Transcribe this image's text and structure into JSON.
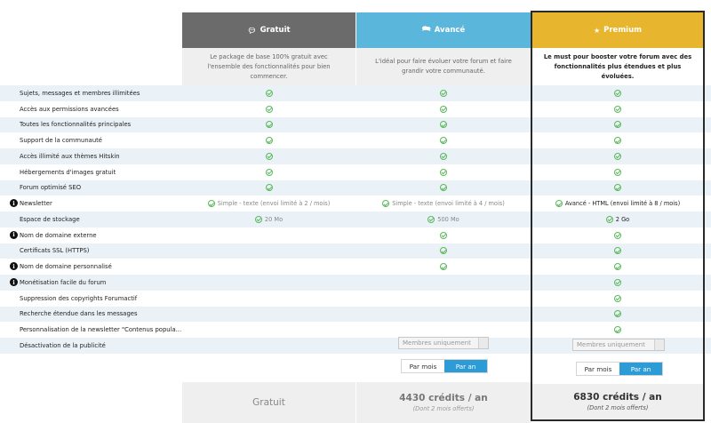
{
  "plans": {
    "gratuit": {
      "name": "Gratuit",
      "icon": "comment-icon",
      "color": "#6b6b6b",
      "description": "Le package de base 100% gratuit avec l'ensemble des fonctionnalités pour bien commencer.",
      "price": "Gratuit"
    },
    "avance": {
      "name": "Avancé",
      "icon": "comments-icon",
      "color": "#5bb6dc",
      "description": "L'idéal pour faire évoluer votre forum et faire grandir votre communauté.",
      "price": "4430 crédits / an",
      "price_note": "(Dont 2 mois offerts)",
      "select_label": "Membres uniquement",
      "toggle_month": "Par mois",
      "toggle_year": "Par an"
    },
    "premium": {
      "name": "Premium",
      "icon": "star-icon",
      "color": "#e8b62e",
      "description": "Le must pour booster votre forum avec des fonctionnalités plus étendues et plus évoluées.",
      "price": "6830 crédits / an",
      "price_note": "(Dont 2 mois offerts)",
      "select_label": "Membres uniquement",
      "toggle_month": "Par mois",
      "toggle_year": "Par an"
    }
  },
  "features": [
    {
      "label": "Sujets, messages et membres illimitées"
    },
    {
      "label": "Accès aux permissions avancées"
    },
    {
      "label": "Toutes les fonctionnalités principales"
    },
    {
      "label": "Support de la communauté"
    },
    {
      "label": "Accès illimité aux thèmes Hitskin"
    },
    {
      "label": "Hébergements d'images gratuit"
    },
    {
      "label": "Forum optimisé SEO"
    },
    {
      "label": "Newsletter",
      "gratuit": "Simple - texte (envoi limité à 2 / mois)",
      "avance": "Simple - texte (envoi limité à 4 / mois)",
      "premium": "Avancé - HTML (envoi limité à 8 / mois)"
    },
    {
      "label": "Espace de stockage",
      "gratuit": "20 Mo",
      "avance": "500 Mo",
      "premium": "2 Go"
    },
    {
      "label": "Nom de domaine externe"
    },
    {
      "label": "Certificats SSL (HTTPS)"
    },
    {
      "label": "Nom de domaine personnalisé"
    },
    {
      "label": "Monétisation facile du forum"
    },
    {
      "label": "Suppression des copyrights Forumactif"
    },
    {
      "label": "Recherche étendue dans les messages"
    },
    {
      "label": "Personnalisation de la newsletter \"Contenus popula..."
    },
    {
      "label": "Désactivation de la publicité"
    }
  ],
  "colors": {
    "stripe": "#eaf2f7",
    "check": "#5cb85c",
    "toggle_active": "#2d9bd6"
  }
}
